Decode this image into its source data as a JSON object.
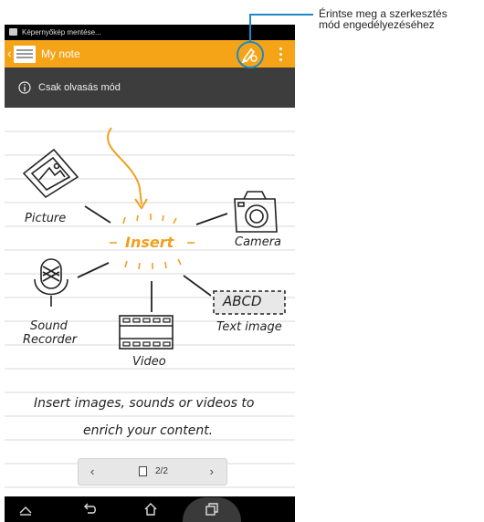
{
  "status_bar": {
    "notification": "Képernyőkép mentése..."
  },
  "action_bar": {
    "back_glyph": "‹",
    "title": "My note",
    "note_icon": "note-icon",
    "edit_icon": "edit-pen-icon",
    "menu_icon": "overflow-menu-icon"
  },
  "mode_bar": {
    "info_icon": "info-icon",
    "label": "Csak olvasás mód"
  },
  "page": {
    "insert_label": "Insert",
    "items": {
      "picture": "Picture",
      "camera": "Camera",
      "sound_line1": "Sound",
      "sound_line2": "Recorder",
      "video": "Video",
      "text_image_sample": "ABCD",
      "text_image": "Text image"
    },
    "caption_line1": "Insert images, sounds or videos to",
    "caption_line2": "enrich your content."
  },
  "pager": {
    "prev_glyph": "‹",
    "next_glyph": "›",
    "page_label": "2/2",
    "current_page": 2,
    "total_pages": 2
  },
  "nav_bar": {
    "icons": [
      "recent-collapse-icon",
      "back-icon",
      "home-icon",
      "recent-apps-icon"
    ]
  },
  "annotation": {
    "line1": "Érintse meg a szerkesztés",
    "line2": "mód engedélyezéséhez"
  },
  "colors": {
    "accent": "#f5a418",
    "toolbar_dark": "#3d3d3d",
    "annotation_circle": "#1e88c8"
  }
}
